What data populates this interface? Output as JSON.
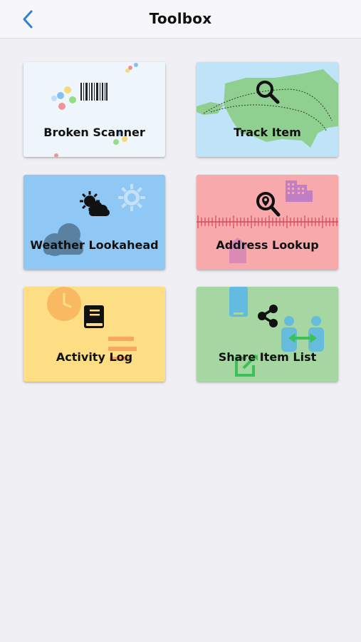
{
  "header": {
    "title": "Toolbox",
    "back_icon": "chevron-left-icon",
    "accent_color": "#2f7fd6"
  },
  "tiles": [
    {
      "label": "Broken Scanner",
      "icon": "barcode-icon",
      "bg_color": "#eef6fb"
    },
    {
      "label": "Track Item",
      "icon": "search-icon",
      "bg_color": "#bfe4f7"
    },
    {
      "label": "Weather Lookahead",
      "icon": "partly-cloudy-icon",
      "bg_color": "#90c8f5"
    },
    {
      "label": "Address Lookup",
      "icon": "location-search-icon",
      "bg_color": "#f7a9ac"
    },
    {
      "label": "Activity Log",
      "icon": "book-icon",
      "bg_color": "#fdde84"
    },
    {
      "label": "Share Item List",
      "icon": "share-icon",
      "bg_color": "#a6d6a1"
    }
  ]
}
